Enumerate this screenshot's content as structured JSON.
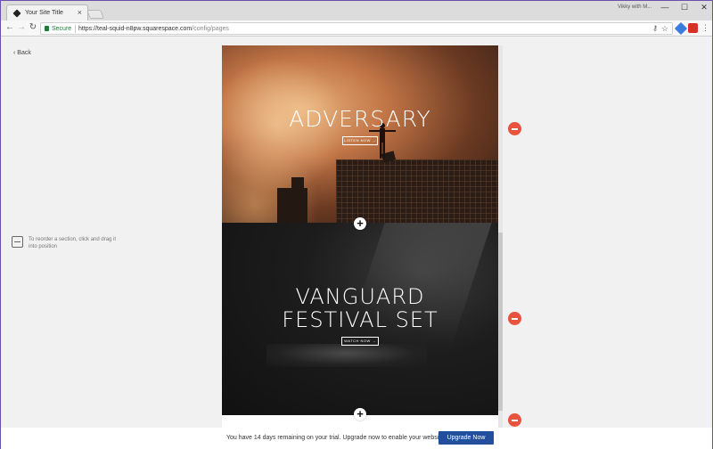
{
  "browser": {
    "tab_title": "Your Site Title",
    "tab_close": "×",
    "window_user": "Vikky with M...",
    "window_controls": {
      "minimize": "—",
      "maximize": "☐",
      "close": "✕"
    },
    "nav": {
      "back": "←",
      "forward": "→",
      "reload": "↻"
    },
    "security_label": "Secure",
    "url_host": "https://teal-squid-n8pw.squarespace.com",
    "url_path": "/config/pages",
    "menu": "⋮",
    "key_icon": "⚷",
    "star_icon": "☆"
  },
  "editor": {
    "back_label": "Back",
    "back_chevron": "‹",
    "reorder_hint": "To reorder a section, click and drag it into position"
  },
  "sections": [
    {
      "title": "ADVERSARY",
      "button": "LISTEN NOW →"
    },
    {
      "title_line1": "VANGUARD",
      "title_line2": "FESTIVAL SET",
      "button": "WATCH NOW →"
    }
  ],
  "controls": {
    "add_glyph": "+"
  },
  "trial": {
    "message": "You have 14 days remaining on your trial. Upgrade now to enable your website.",
    "button": "Upgrade Now"
  },
  "colors": {
    "accent": "#224e9b",
    "remove": "#e8533e",
    "secure": "#188038"
  }
}
